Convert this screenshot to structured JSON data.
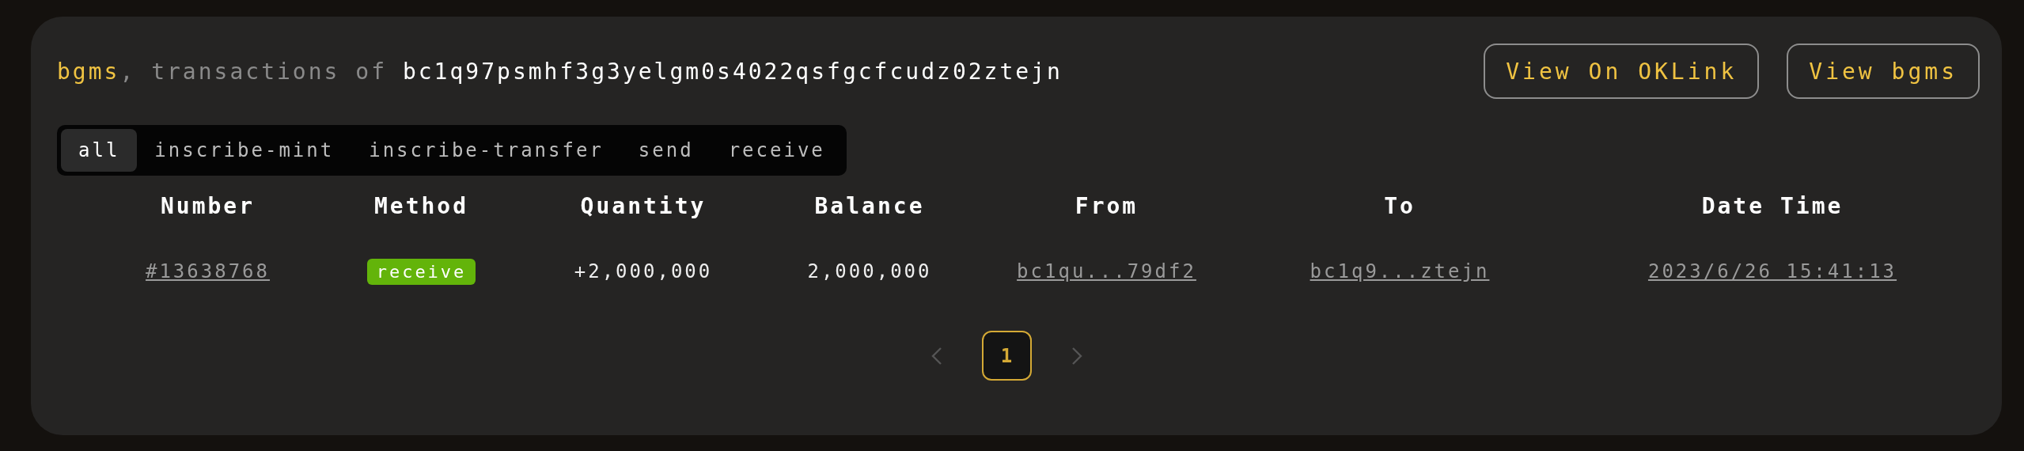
{
  "header": {
    "token": "bgms",
    "separator": ",",
    "connector": "transactions of",
    "address": "bc1q97psmhf3g3yelgm0s4022qsfgcfcudz02ztejn"
  },
  "buttons": [
    {
      "label": "View On OKLink"
    },
    {
      "label": "View bgms"
    }
  ],
  "tabs": [
    {
      "label": "all",
      "selected": true
    },
    {
      "label": "inscribe-mint",
      "selected": false
    },
    {
      "label": "inscribe-transfer",
      "selected": false
    },
    {
      "label": "send",
      "selected": false
    },
    {
      "label": "receive",
      "selected": false
    }
  ],
  "table": {
    "columns": [
      "Number",
      "Method",
      "Quantity",
      "Balance",
      "From",
      "To",
      "Date Time"
    ],
    "rows": [
      {
        "number": "#13638768",
        "method": {
          "label": "receive",
          "color": "#63b40a"
        },
        "quantity": "+2,000,000",
        "balance": "2,000,000",
        "from": "bc1qu...79df2",
        "to": "bc1q9...ztejn",
        "datetime": "2023/6/26 15:41:13"
      }
    ]
  },
  "pagination": {
    "prev": {
      "disabled": true
    },
    "pages": [
      {
        "label": "1",
        "selected": true
      }
    ],
    "next": {
      "disabled": true
    }
  }
}
